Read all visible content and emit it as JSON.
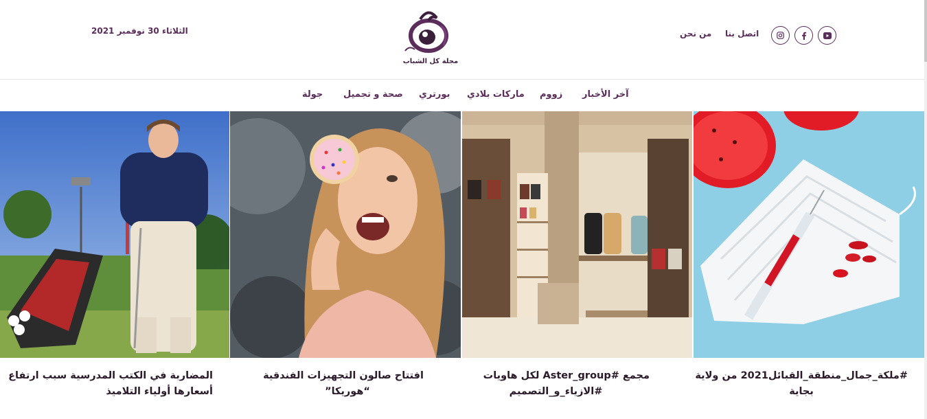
{
  "header": {
    "date": "الثلاثاء 30 نوفمبر 2021",
    "logo_tagline": "مجلة كل الشباب",
    "links": {
      "contact": "اتصل بنا",
      "about": "من نحن"
    },
    "social": [
      "youtube-icon",
      "facebook-icon",
      "instagram-icon"
    ],
    "accent_color": "#5a2d5a"
  },
  "nav": {
    "items": [
      "آخر الأخبار",
      "زووم",
      "ماركات بلادي",
      "بورتري",
      "صحة و تجميل",
      "جولة"
    ]
  },
  "articles": [
    {
      "title_line1": "#ملكة_جمال_منطقة_القبائل2021 من ولاية",
      "title_line2": "بجاية"
    },
    {
      "title_line1": "مجمع #Aster_group لكل هاويات",
      "title_line2": "#الازياء_و_التصميم"
    },
    {
      "title_line1": "افتتاح صالون التجهيزات الفندقية",
      "title_line2": "“هوريكا”"
    },
    {
      "title_line1": "المضاربة في الكتب المدرسية سبب ارتفاع",
      "title_line2": "أسعارها أولياء التلاميذ"
    }
  ]
}
